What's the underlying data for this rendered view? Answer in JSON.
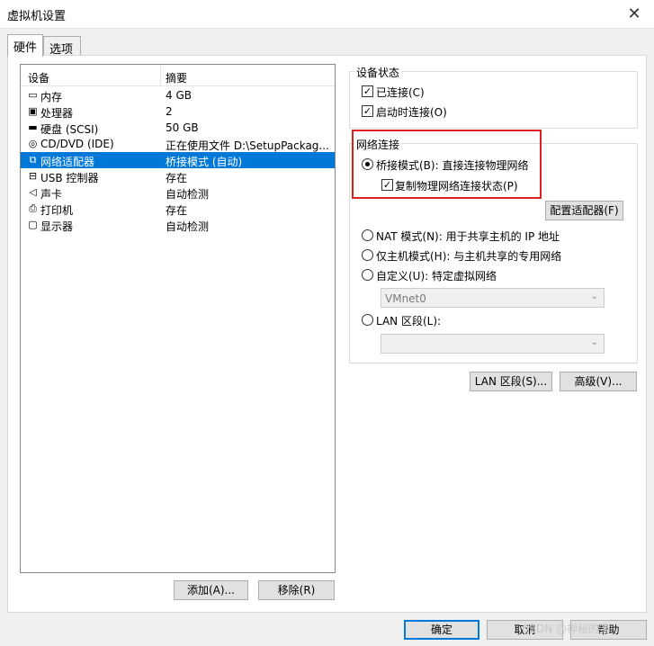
{
  "window": {
    "title": "虚拟机设置",
    "close_glyph": "✕"
  },
  "tabs": [
    {
      "label": "硬件"
    },
    {
      "label": "选项"
    }
  ],
  "device_list": {
    "col_device": "设备",
    "col_summary": "摘要",
    "rows": [
      {
        "icon": "memory-icon",
        "glyph": "▭",
        "name": "内存",
        "summary": "4 GB"
      },
      {
        "icon": "processor-icon",
        "glyph": "▣",
        "name": "处理器",
        "summary": "2"
      },
      {
        "icon": "hard-disk-icon",
        "glyph": "▬",
        "name": "硬盘 (SCSI)",
        "summary": "50 GB"
      },
      {
        "icon": "cd-dvd-icon",
        "glyph": "◎",
        "name": "CD/DVD (IDE)",
        "summary": "正在使用文件 D:\\SetupPackag..."
      },
      {
        "icon": "network-adapter-icon",
        "glyph": "⧉",
        "name": "网络适配器",
        "summary": "桥接模式 (自动)",
        "selected": true
      },
      {
        "icon": "usb-icon",
        "glyph": "⊟",
        "name": "USB 控制器",
        "summary": "存在"
      },
      {
        "icon": "sound-card-icon",
        "glyph": "◁",
        "name": "声卡",
        "summary": "自动检测"
      },
      {
        "icon": "printer-icon",
        "glyph": "⎙",
        "name": "打印机",
        "summary": "存在"
      },
      {
        "icon": "display-icon",
        "glyph": "▢",
        "name": "显示器",
        "summary": "自动检测"
      }
    ]
  },
  "buttons": {
    "add": "添加(A)...",
    "remove": "移除(R)",
    "configure_adapter": "配置适配器(F)",
    "lan_segments": "LAN 区段(S)...",
    "advanced": "高级(V)...",
    "ok": "确定",
    "cancel": "取消",
    "help": "帮助"
  },
  "device_status": {
    "label": "设备状态",
    "connected": {
      "label": "已连接(C)",
      "checked": true
    },
    "connect_at_power_on": {
      "label": "启动时连接(O)",
      "checked": true
    }
  },
  "network": {
    "label": "网络连接",
    "bridged": {
      "label": "桥接模式(B): 直接连接物理网络",
      "selected": true
    },
    "replicate": {
      "label": "复制物理网络连接状态(P)",
      "checked": true
    },
    "nat": {
      "label": "NAT 模式(N): 用于共享主机的 IP 地址"
    },
    "host_only": {
      "label": "仅主机模式(H): 与主机共享的专用网络"
    },
    "custom": {
      "label": "自定义(U): 特定虚拟网络",
      "combo_value": "VMnet0"
    },
    "lan_segment": {
      "label": "LAN 区段(L):",
      "combo_value": ""
    }
  },
  "colors": {
    "selection": "#0078d7",
    "highlight_box": "#e02020"
  },
  "watermark": "CSDN @神秘的笑"
}
